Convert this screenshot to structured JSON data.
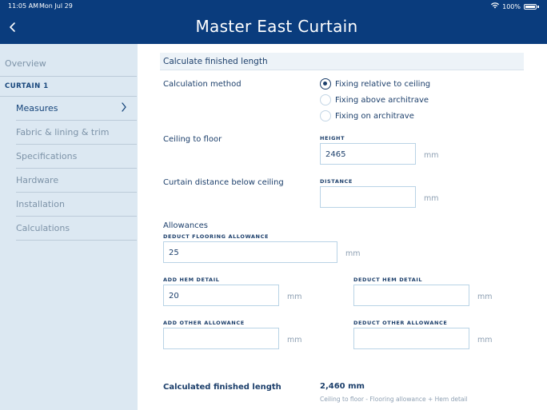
{
  "status_bar": {
    "time": "11:05 AM",
    "date": "Mon Jul 29",
    "battery": "100%"
  },
  "header": {
    "title": "Master East Curtain"
  },
  "sidebar": {
    "overview": "Overview",
    "section": "CURTAIN 1",
    "items": [
      {
        "label": "Measures"
      },
      {
        "label": "Fabric & lining & trim"
      },
      {
        "label": "Specifications"
      },
      {
        "label": "Hardware"
      },
      {
        "label": "Installation"
      },
      {
        "label": "Calculations"
      }
    ]
  },
  "main": {
    "section_title": "Calculate finished length",
    "calc_method": {
      "label": "Calculation method",
      "options": [
        {
          "label": "Fixing relative to ceiling",
          "selected": true
        },
        {
          "label": "Fixing above architrave",
          "selected": false
        },
        {
          "label": "Fixing on architrave",
          "selected": false
        }
      ]
    },
    "ceiling_to_floor": {
      "label": "Ceiling to floor",
      "caption": "HEIGHT",
      "value": "2465",
      "unit": "mm"
    },
    "curtain_distance": {
      "label": "Curtain distance below ceiling",
      "caption": "DISTANCE",
      "value": "",
      "unit": "mm"
    },
    "allowances": {
      "label": "Allowances",
      "deduct_flooring": {
        "caption": "DEDUCT FLOORING ALLOWANCE",
        "value": "25",
        "unit": "mm"
      },
      "add_hem": {
        "caption": "ADD HEM DETAIL",
        "value": "20",
        "unit": "mm"
      },
      "deduct_hem": {
        "caption": "DEDUCT HEM DETAIL",
        "value": "",
        "unit": "mm"
      },
      "add_other": {
        "caption": "ADD OTHER ALLOWANCE",
        "value": "",
        "unit": "mm"
      },
      "deduct_other": {
        "caption": "DEDUCT OTHER ALLOWANCE",
        "value": "",
        "unit": "mm"
      }
    },
    "result": {
      "label": "Calculated finished length",
      "value": "2,460 mm",
      "formula": "Ceiling to floor - Flooring allowance + Hem detail"
    }
  },
  "colors": {
    "header_bg": "#0a3c7d",
    "sidebar_bg": "#dce8f2",
    "text_primary": "#1c3f6b",
    "input_border": "#b9d3e6"
  }
}
